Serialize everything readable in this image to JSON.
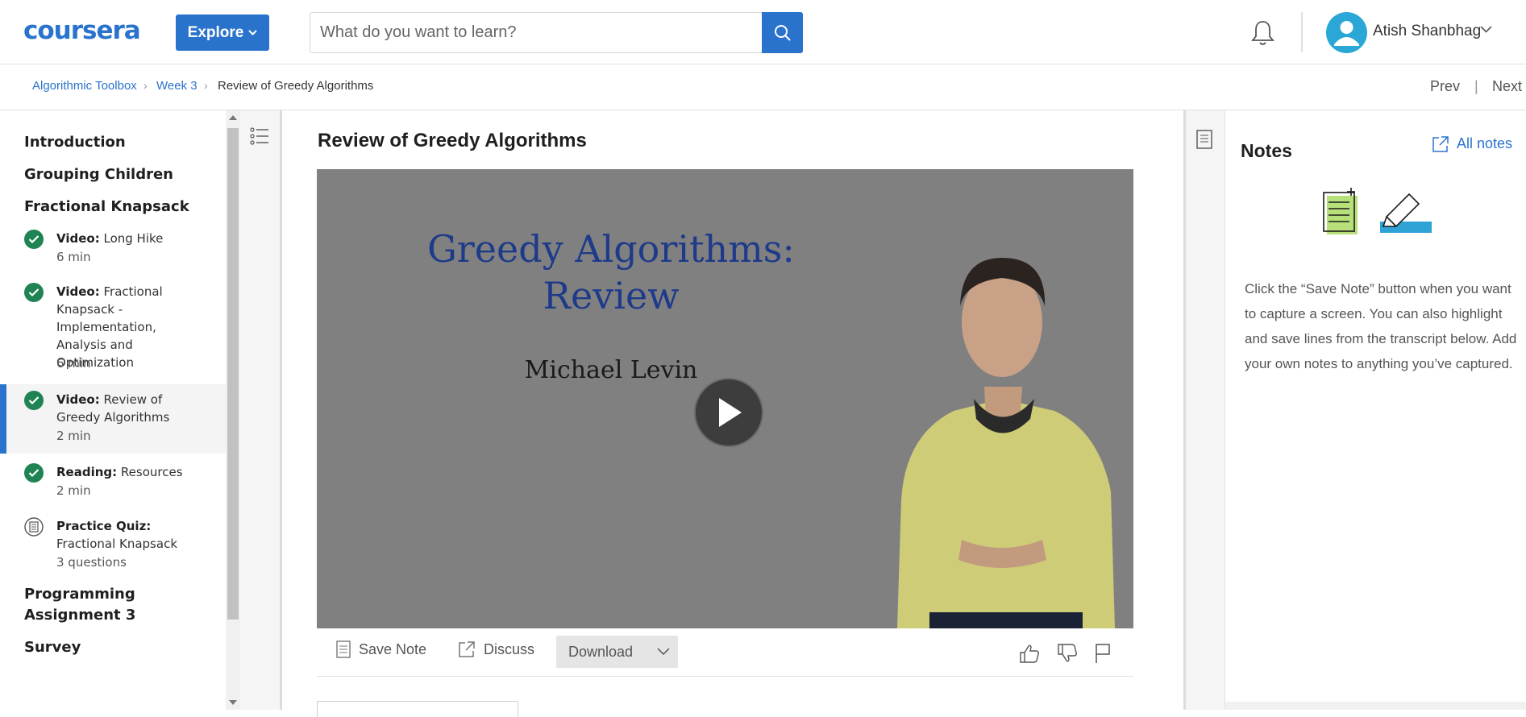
{
  "header": {
    "logo_text": "coursera",
    "explore_label": "Explore",
    "search_placeholder": "What do you want to learn?",
    "user_name": "Atish Shanbhag"
  },
  "breadcrumb": {
    "items": [
      "Algorithmic Toolbox",
      "Week 3",
      "Review of Greedy Algorithms"
    ],
    "prev_label": "Prev",
    "separator": "|",
    "next_label": "Next"
  },
  "sidebar": {
    "sections": [
      "Introduction",
      "Grouping Children",
      "Fractional Knapsack",
      "Programming Assignment 3",
      "Survey"
    ],
    "items": [
      {
        "type": "Video:",
        "title": "Long Hike",
        "meta": "6 min",
        "status": "completed"
      },
      {
        "type": "Video:",
        "title": "Fractional Knapsack - Implementation, Analysis and Optimization",
        "meta": "6 min",
        "status": "completed"
      },
      {
        "type": "Video:",
        "title": "Review of Greedy Algorithms",
        "meta": "2 min",
        "status": "completed",
        "active": true
      },
      {
        "type": "Reading:",
        "title": "Resources",
        "meta": "2 min",
        "status": "completed"
      },
      {
        "type": "Practice Quiz:",
        "title": "Fractional Knapsack",
        "meta": "3 questions",
        "status": "quiz"
      }
    ]
  },
  "main": {
    "lesson_title": "Review of Greedy Algorithms",
    "video": {
      "slide_title_line1": "Greedy Algorithms:",
      "slide_title_line2": "Review",
      "slide_author": "Michael Levin"
    },
    "controls": {
      "save_note_label": "Save Note",
      "discuss_label": "Discuss",
      "download_label": "Download"
    }
  },
  "notes": {
    "title": "Notes",
    "all_notes_label": "All notes",
    "help_text": "Click the “Save Note” button when you want to capture a screen. You can also highlight and save lines from the transcript below. Add your own notes to anything you’ve captured."
  },
  "colors": {
    "brand": "#2a73cc",
    "completed": "#1f8354",
    "highlighter": "#2fa3d6",
    "note_green": "#b7e07a"
  },
  "icons": [
    "search-icon",
    "bell-icon",
    "user-avatar-icon",
    "chevron-down-icon",
    "checkmark-icon",
    "quiz-icon",
    "list-icon",
    "play-icon",
    "save-note-icon",
    "discuss-icon",
    "thumbs-up-icon",
    "thumbs-down-icon",
    "flag-icon",
    "notes-icon",
    "external-link-icon"
  ]
}
